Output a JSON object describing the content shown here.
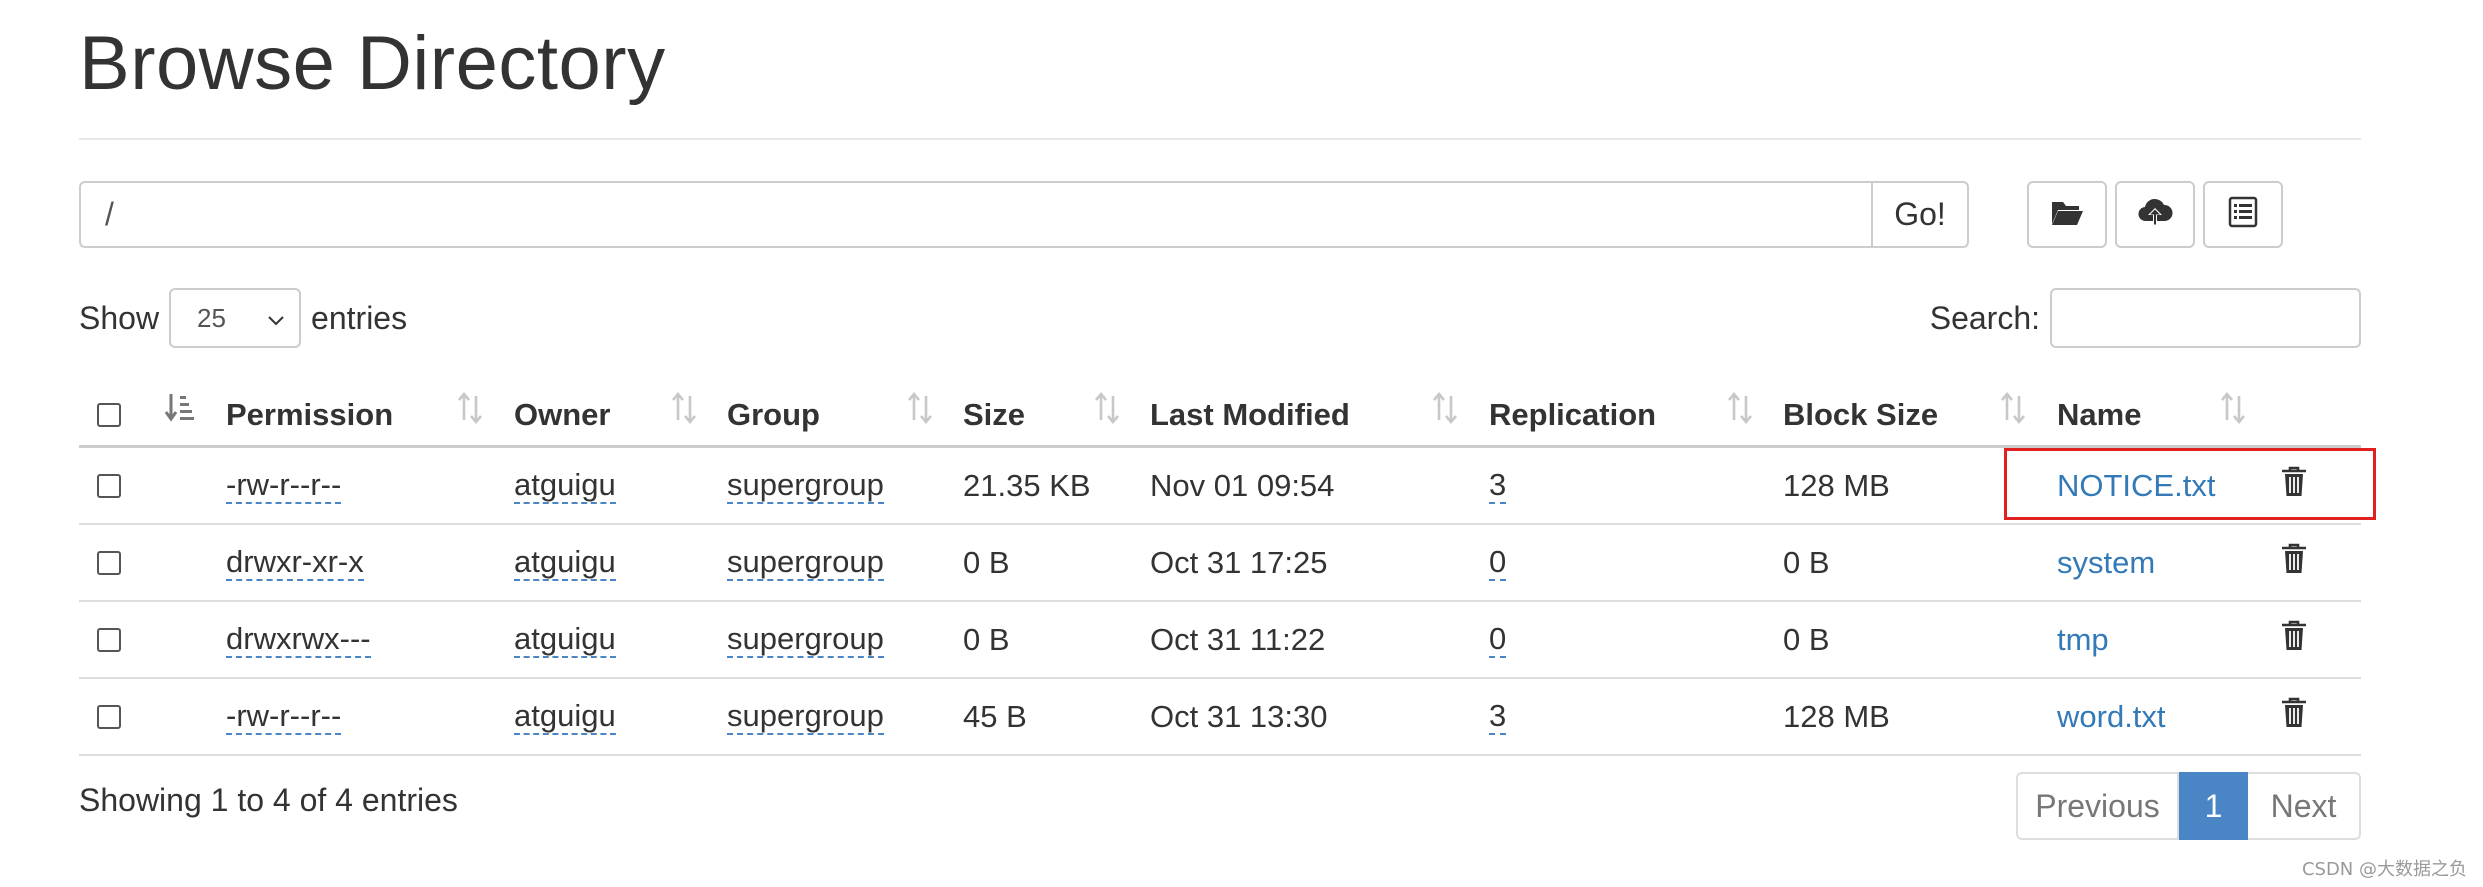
{
  "page": {
    "title": "Browse Directory"
  },
  "path_bar": {
    "value": "/",
    "go_label": "Go!"
  },
  "toolbar": {
    "icons": [
      "folder-open-icon",
      "cloud-upload-icon",
      "list-icon"
    ]
  },
  "show": {
    "prefix": "Show",
    "value": "25",
    "suffix": "entries"
  },
  "search": {
    "label": "Search:",
    "value": ""
  },
  "table": {
    "headers": {
      "permission": "Permission",
      "owner": "Owner",
      "group": "Group",
      "size": "Size",
      "modified": "Last Modified",
      "replication": "Replication",
      "block_size": "Block Size",
      "name": "Name"
    },
    "rows": [
      {
        "permission": "-rw-r--r--",
        "owner": "atguigu",
        "group": "supergroup",
        "size": "21.35 KB",
        "modified": "Nov 01 09:54",
        "replication": "3",
        "block_size": "128 MB",
        "name": "NOTICE.txt"
      },
      {
        "permission": "drwxr-xr-x",
        "owner": "atguigu",
        "group": "supergroup",
        "size": "0 B",
        "modified": "Oct 31 17:25",
        "replication": "0",
        "block_size": "0 B",
        "name": "system"
      },
      {
        "permission": "drwxrwx---",
        "owner": "atguigu",
        "group": "supergroup",
        "size": "0 B",
        "modified": "Oct 31 11:22",
        "replication": "0",
        "block_size": "0 B",
        "name": "tmp"
      },
      {
        "permission": "-rw-r--r--",
        "owner": "atguigu",
        "group": "supergroup",
        "size": "45 B",
        "modified": "Oct 31 13:30",
        "replication": "3",
        "block_size": "128 MB",
        "name": "word.txt"
      }
    ]
  },
  "footer": {
    "info": "Showing 1 to 4 of 4 entries"
  },
  "pagination": {
    "previous": "Previous",
    "current": "1",
    "next": "Next"
  },
  "watermark": "CSDN @大数据之负",
  "colors": {
    "link": "#337ab7",
    "accent": "#4a86c5",
    "highlight": "#e02020"
  }
}
